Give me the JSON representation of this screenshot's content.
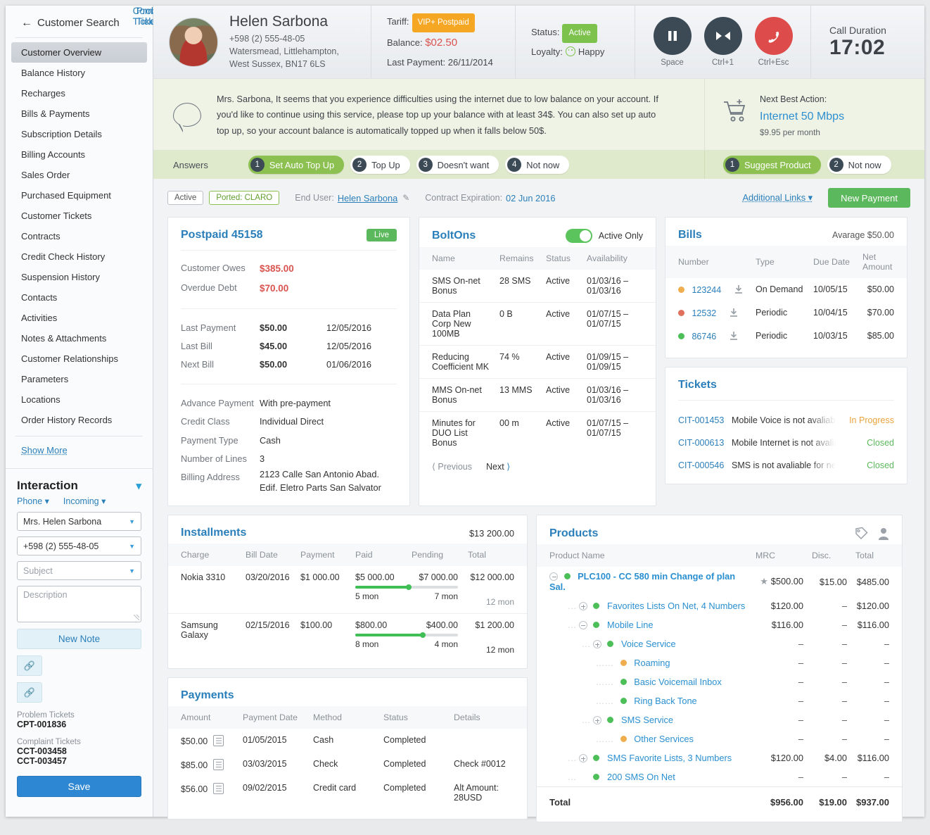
{
  "sidebar": {
    "back_label": "Customer Search",
    "items": [
      {
        "label": "Customer Overview",
        "active": true
      },
      {
        "label": "Balance History"
      },
      {
        "label": "Recharges"
      },
      {
        "label": "Bills & Payments"
      },
      {
        "label": "Subscription Details"
      },
      {
        "label": "Billing Accounts"
      },
      {
        "label": "Sales Order"
      },
      {
        "label": "Purchased Equipment"
      },
      {
        "label": "Customer Tickets"
      },
      {
        "label": "Contracts"
      },
      {
        "label": "Credit Check History"
      },
      {
        "label": "Suspension History"
      },
      {
        "label": "Contacts"
      },
      {
        "label": "Activities"
      },
      {
        "label": "Notes & Attachments"
      },
      {
        "label": "Customer Relationships"
      },
      {
        "label": "Parameters"
      },
      {
        "label": "Locations"
      },
      {
        "label": "Order History Records"
      }
    ],
    "show_more": "Show More"
  },
  "interaction": {
    "title": "Interaction",
    "channel": "Phone",
    "direction": "Incoming",
    "contact_value": "Mrs. Helen Sarbona",
    "phone_value": "+598 (2) 555-48-05",
    "subject_placeholder": "Subject",
    "description_placeholder": "Description",
    "new_note": "New Note",
    "problem_ticket": "Problem Ticket",
    "complaint_ticket": "Complaint Ticket",
    "problem_tickets_label": "Problem Tickets",
    "problem_tickets": [
      "CPT-001836"
    ],
    "complaint_tickets_label": "Complaint Tickets",
    "complaint_tickets": [
      "CCT-003458",
      "CCT-003457"
    ],
    "save": "Save"
  },
  "header": {
    "customer_name": "Helen Sarbona",
    "phone": "+598 (2) 555-48-05",
    "address_line1": "Watersmead, Littlehampton,",
    "address_line2": "West Sussex, BN17 6LS",
    "tariff_label": "Tariff:",
    "tariff_value": "VIP+ Postpaid",
    "balance_label": "Balance:",
    "balance_value": "$02.50",
    "last_payment_label": "Last Payment:",
    "last_payment_value": "26/11/2014",
    "status_label": "Status:",
    "status_value": "Active",
    "loyalty_label": "Loyalty:",
    "loyalty_value": "Happy",
    "controls": [
      {
        "icon": "pause-icon",
        "shortcut": "Space"
      },
      {
        "icon": "transfer-icon",
        "shortcut": "Ctrl+1"
      },
      {
        "icon": "hangup-icon",
        "shortcut": "Ctrl+Esc"
      }
    ],
    "call_duration_label": "Call Duration",
    "call_duration_value": "17:02"
  },
  "script": {
    "text": "Mrs. Sarbona, It seems that you experience difficulties using the internet due to low balance on your account. If you'd like to continue using this service, please top up your balance with at least 34$. You can also set up auto top up, so your account balance is automatically topped up when it falls below 50$.",
    "answers_label": "Answers",
    "answers": [
      {
        "num": "1",
        "label": "Set Auto Top Up",
        "selected": true
      },
      {
        "num": "2",
        "label": "Top Up",
        "selected": false
      },
      {
        "num": "3",
        "label": "Doesn't want",
        "selected": false
      },
      {
        "num": "4",
        "label": "Not now",
        "selected": false
      }
    ],
    "nba_label": "Next Best Action:",
    "nba_product": "Internet 50 Mbps",
    "nba_price": "$9.95 per month",
    "nba_answers": [
      {
        "num": "1",
        "label": "Suggest Product",
        "selected": true
      },
      {
        "num": "2",
        "label": "Not now",
        "selected": false
      }
    ]
  },
  "toolbar": {
    "status_badge": "Active",
    "ported_badge": "Ported: CLARO",
    "end_user_label": "End User:",
    "end_user_value": "Helen Sarbona",
    "contract_label": "Contract Expiration:",
    "contract_value": "02 Jun 2016",
    "additional_links": "Additional Links",
    "new_payment": "New Payment"
  },
  "postpaid": {
    "title": "Postpaid 45158",
    "badge": "Live",
    "owes_label": "Customer Owes",
    "owes_value": "$385.00",
    "overdue_label": "Overdue Debt",
    "overdue_value": "$70.00",
    "rows": [
      {
        "label": "Last Payment",
        "amount": "$50.00",
        "date": "12/05/2016"
      },
      {
        "label": "Last Bill",
        "amount": "$45.00",
        "date": "12/05/2016"
      },
      {
        "label": "Next Bill",
        "amount": "$50.00",
        "date": "01/06/2016"
      }
    ],
    "details": [
      {
        "label": "Advance Payment",
        "value": "With pre-payment"
      },
      {
        "label": "Credit Class",
        "value": "Individual Direct"
      },
      {
        "label": "Payment Type",
        "value": "Cash"
      },
      {
        "label": "Number of Lines",
        "value": "3"
      },
      {
        "label": "Billing Address",
        "value": "2123 Calle San Antonio Abad. Edif. Eletro Parts San Salvator"
      }
    ]
  },
  "boltons": {
    "title": "BoltOns",
    "toggle_label": "Active Only",
    "columns": [
      "Name",
      "Remains",
      "Status",
      "Availability"
    ],
    "rows": [
      {
        "name": "SMS On-net Bonus",
        "remains": "28 SMS",
        "status": "Active",
        "availability": "01/03/16 – 01/03/16"
      },
      {
        "name": "Data Plan Corp New 100MB",
        "remains": "0 B",
        "status": "Active",
        "availability": "01/07/15 – 01/07/15"
      },
      {
        "name": "Reducing Coefficient MK",
        "remains": "74 %",
        "status": "Active",
        "availability": "01/09/15 – 01/09/15"
      },
      {
        "name": "MMS On-net Bonus",
        "remains": "13 MMS",
        "status": "Active",
        "availability": "01/03/16 – 01/03/16"
      },
      {
        "name": "Minutes for DUO List Bonus",
        "remains": "00 m",
        "status": "Active",
        "availability": "01/07/15 – 01/07/15"
      }
    ],
    "previous": "Previous",
    "next": "Next"
  },
  "bills": {
    "title": "Bills",
    "average": "Avarage $50.00",
    "columns": [
      "Number",
      "Type",
      "Due Date",
      "Net Amount"
    ],
    "rows": [
      {
        "number": "123244",
        "type": "On Demand",
        "due": "10/05/15",
        "amount": "$50.00",
        "dot": "#f0ad4e"
      },
      {
        "number": "12532",
        "type": "Periodic",
        "due": "10/04/15",
        "amount": "$70.00",
        "dot": "#e0705c"
      },
      {
        "number": "86746",
        "type": "Periodic",
        "due": "10/03/15",
        "amount": "$85.00",
        "dot": "#4cbf58"
      }
    ]
  },
  "tickets": {
    "title": "Tickets",
    "rows": [
      {
        "id": "CIT-001453",
        "text": "Mobile Voice is not avaliable for next three months",
        "status": "In Progress",
        "state": "progress"
      },
      {
        "id": "CIT-000613",
        "text": "Mobile Internet is not avaliable for next three months",
        "status": "Closed",
        "state": "closed"
      },
      {
        "id": "CIT-000546",
        "text": "SMS is not avaliable for next three months",
        "status": "Closed",
        "state": "closed"
      }
    ]
  },
  "installments": {
    "title": "Installments",
    "total": "$13 200.00",
    "columns": [
      "Charge",
      "Bill Date",
      "Payment",
      "Paid",
      "Pending",
      "Total"
    ],
    "rows": [
      {
        "charge": "Nokia 3310",
        "bill_date": "03/20/2016",
        "payment": "$1 000.00",
        "paid": "$5 000.00",
        "pending": "$7 000.00",
        "total": "$12 000.00",
        "paid_mon": "5 mon",
        "pending_mon": "7 mon",
        "total_mon": "12 mon",
        "progress": 52,
        "total_mon_muted": true
      },
      {
        "charge": "Samsung Galaxy",
        "bill_date": "02/15/2016",
        "payment": "$100.00",
        "paid": "$800.00",
        "pending": "$400.00",
        "total": "$1 200.00",
        "paid_mon": "8 mon",
        "pending_mon": "4 mon",
        "total_mon": "12 mon",
        "progress": 66,
        "total_mon_muted": false
      }
    ]
  },
  "payments": {
    "title": "Payments",
    "columns": [
      "Amount",
      "Payment Date",
      "Method",
      "Status",
      "Details"
    ],
    "rows": [
      {
        "amount": "$50.00",
        "date": "01/05/2015",
        "method": "Cash",
        "status": "Completed",
        "details": ""
      },
      {
        "amount": "$85.00",
        "date": "03/03/2015",
        "method": "Check",
        "status": "Completed",
        "details": "Check #0012"
      },
      {
        "amount": "$56.00",
        "date": "09/02/2015",
        "method": "Credit card",
        "status": "Completed",
        "details": "Alt Amount: 28USD"
      }
    ]
  },
  "products": {
    "title": "Products",
    "columns": [
      "Product Name",
      "MRC",
      "Disc.",
      "Total"
    ],
    "rows": [
      {
        "name": "PLC100 - CC 580 min Change of plan Sal.",
        "level": 0,
        "expander": "minus",
        "dot": "#4cbf58",
        "bold": true,
        "star": true,
        "mrc": "$500.00",
        "disc": "$15.00",
        "total": "$485.00"
      },
      {
        "name": "Favorites Lists On Net, 4 Numbers",
        "level": 1,
        "expander": "plus",
        "dot": "#4cbf58",
        "bold": false,
        "star": false,
        "mrc": "$120.00",
        "disc": "–",
        "total": "$120.00"
      },
      {
        "name": "Mobile Line",
        "level": 1,
        "expander": "minus",
        "dot": "#4cbf58",
        "bold": false,
        "star": false,
        "mrc": "$116.00",
        "disc": "–",
        "total": "$116.00"
      },
      {
        "name": "Voice Service",
        "level": 2,
        "expander": "plus",
        "dot": "#4cbf58",
        "bold": false,
        "star": false,
        "mrc": "–",
        "disc": "–",
        "total": "–"
      },
      {
        "name": "Roaming",
        "level": 3,
        "expander": "none",
        "dot": "#f0ad4e",
        "bold": false,
        "star": false,
        "mrc": "–",
        "disc": "–",
        "total": "–"
      },
      {
        "name": "Basic Voicemail Inbox",
        "level": 3,
        "expander": "none",
        "dot": "#4cbf58",
        "bold": false,
        "star": false,
        "mrc": "–",
        "disc": "–",
        "total": "–"
      },
      {
        "name": "Ring Back Tone",
        "level": 3,
        "expander": "none",
        "dot": "#4cbf58",
        "bold": false,
        "star": false,
        "mrc": "–",
        "disc": "–",
        "total": "–"
      },
      {
        "name": "SMS Service",
        "level": 2,
        "expander": "plus",
        "dot": "#4cbf58",
        "bold": false,
        "star": false,
        "mrc": "–",
        "disc": "–",
        "total": "–"
      },
      {
        "name": "Other Services",
        "level": 3,
        "expander": "none",
        "dot": "#f0ad4e",
        "bold": false,
        "star": false,
        "mrc": "–",
        "disc": "–",
        "total": "–"
      },
      {
        "name": "SMS Favorite Lists, 3 Numbers",
        "level": 1,
        "expander": "plus",
        "dot": "#4cbf58",
        "bold": false,
        "star": false,
        "mrc": "$120.00",
        "disc": "$4.00",
        "total": "$116.00"
      },
      {
        "name": "200 SMS On Net",
        "level": 1,
        "expander": "none",
        "dot": "#4cbf58",
        "bold": false,
        "star": false,
        "mrc": "–",
        "disc": "–",
        "total": "–"
      }
    ],
    "total_label": "Total",
    "total_mrc": "$956.00",
    "total_disc": "$19.00",
    "total_total": "$937.00"
  },
  "colors": {
    "accent_blue": "#2a7fba",
    "green": "#5cb85c",
    "orange": "#f5a623",
    "red": "#d9534f"
  }
}
